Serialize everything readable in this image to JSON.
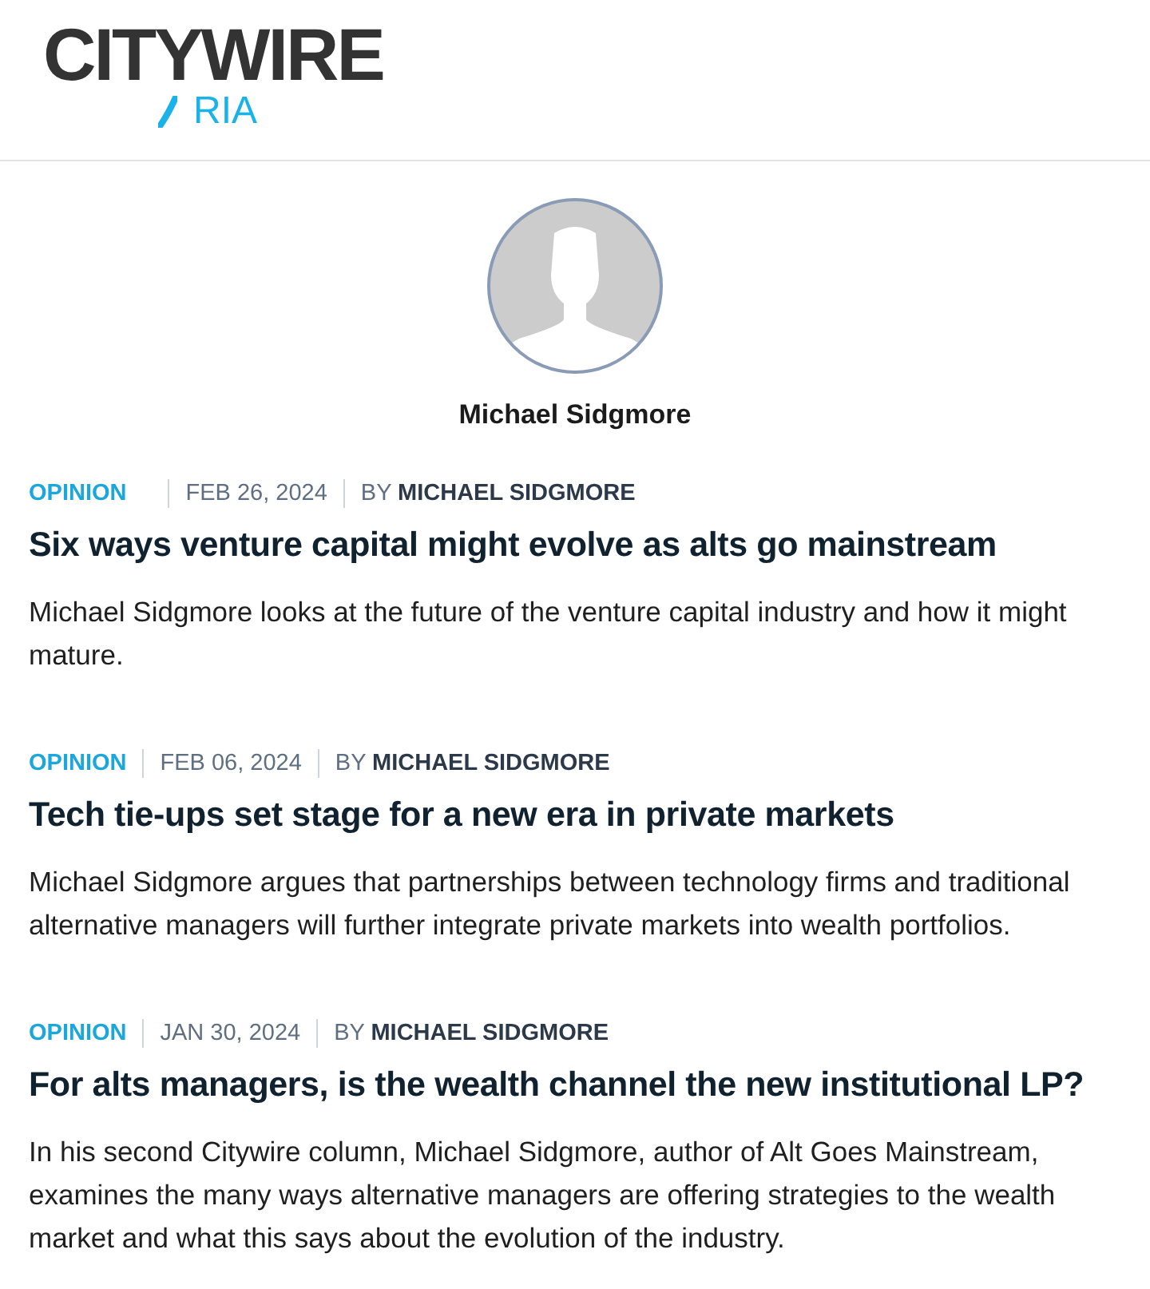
{
  "header": {
    "logo": {
      "wordmark": "CITYWIRE",
      "sub": "RIA"
    }
  },
  "author": {
    "name": "Michael Sidgmore"
  },
  "articles": [
    {
      "category": "OPINION",
      "date": "FEB 26, 2024",
      "byline": "BY **MICHAEL SIDGMORE**",
      "title": "Six ways venture capital might evolve as alts go mainstream",
      "summary": "Michael Sidgmore looks at the future of the venture capital industry and how it might mature."
    },
    {
      "category": "OPINION",
      "date": "FEB 06, 2024",
      "byline": "BY **MICHAEL SIDGMORE**",
      "title": "Tech tie-ups set stage for a new era in private markets",
      "summary": "Michael Sidgmore argues that partnerships between technology firms and traditional alternative managers will further integrate private markets into wealth portfolios."
    },
    {
      "category": "OPINION",
      "date": "JAN 30, 2024",
      "byline": "BY **MICHAEL SIDGMORE**",
      "title": "For alts managers, is the wealth channel the new institutional LP?",
      "summary": "In his second Citywire column, Michael Sidgmore, author of Alt Goes Mainstream, examines the many ways alternative managers are offering strategies to the wealth market and what this says about the evolution of the industry."
    }
  ]
}
